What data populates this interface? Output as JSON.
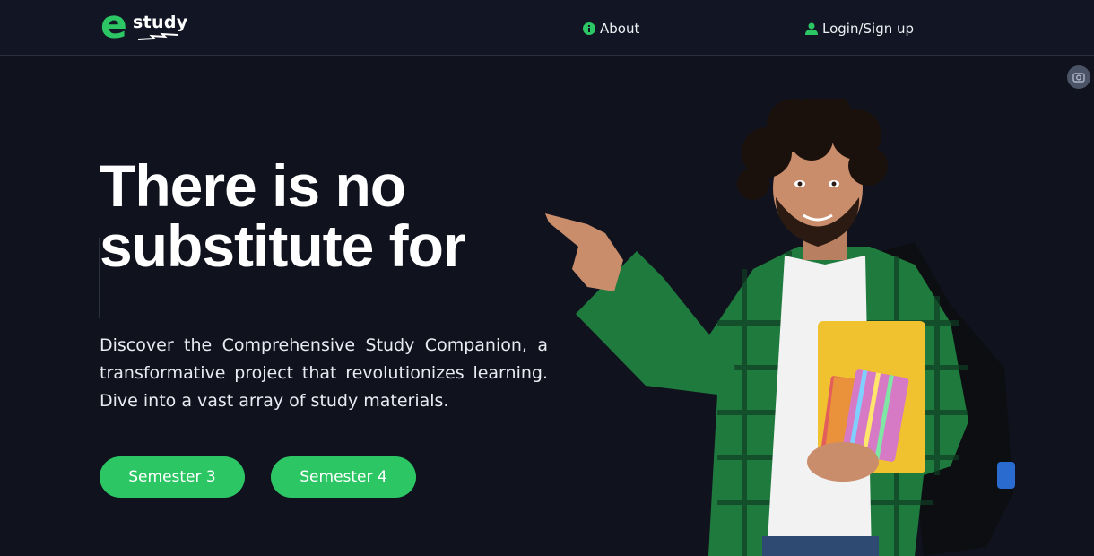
{
  "brand": {
    "logo_letter": "e",
    "logo_text": "study",
    "accent_color": "#2cc764"
  },
  "nav": {
    "about": {
      "label": "About",
      "icon": "info-circle-icon"
    },
    "login": {
      "label": "Login/Sign up",
      "icon": "user-icon"
    }
  },
  "hero": {
    "title_line1": "There is no",
    "title_line2": "substitute for",
    "description": "Discover the Comprehensive Study Companion, a transformative project that revolutionizes learning. Dive into a vast array of study materials.",
    "buttons": [
      {
        "label": "Semester 3"
      },
      {
        "label": "Semester 4"
      }
    ],
    "image": "student-pointing-illustration"
  },
  "colors": {
    "background": "#10121d",
    "navbar": "#121624",
    "accent": "#2cc764"
  }
}
